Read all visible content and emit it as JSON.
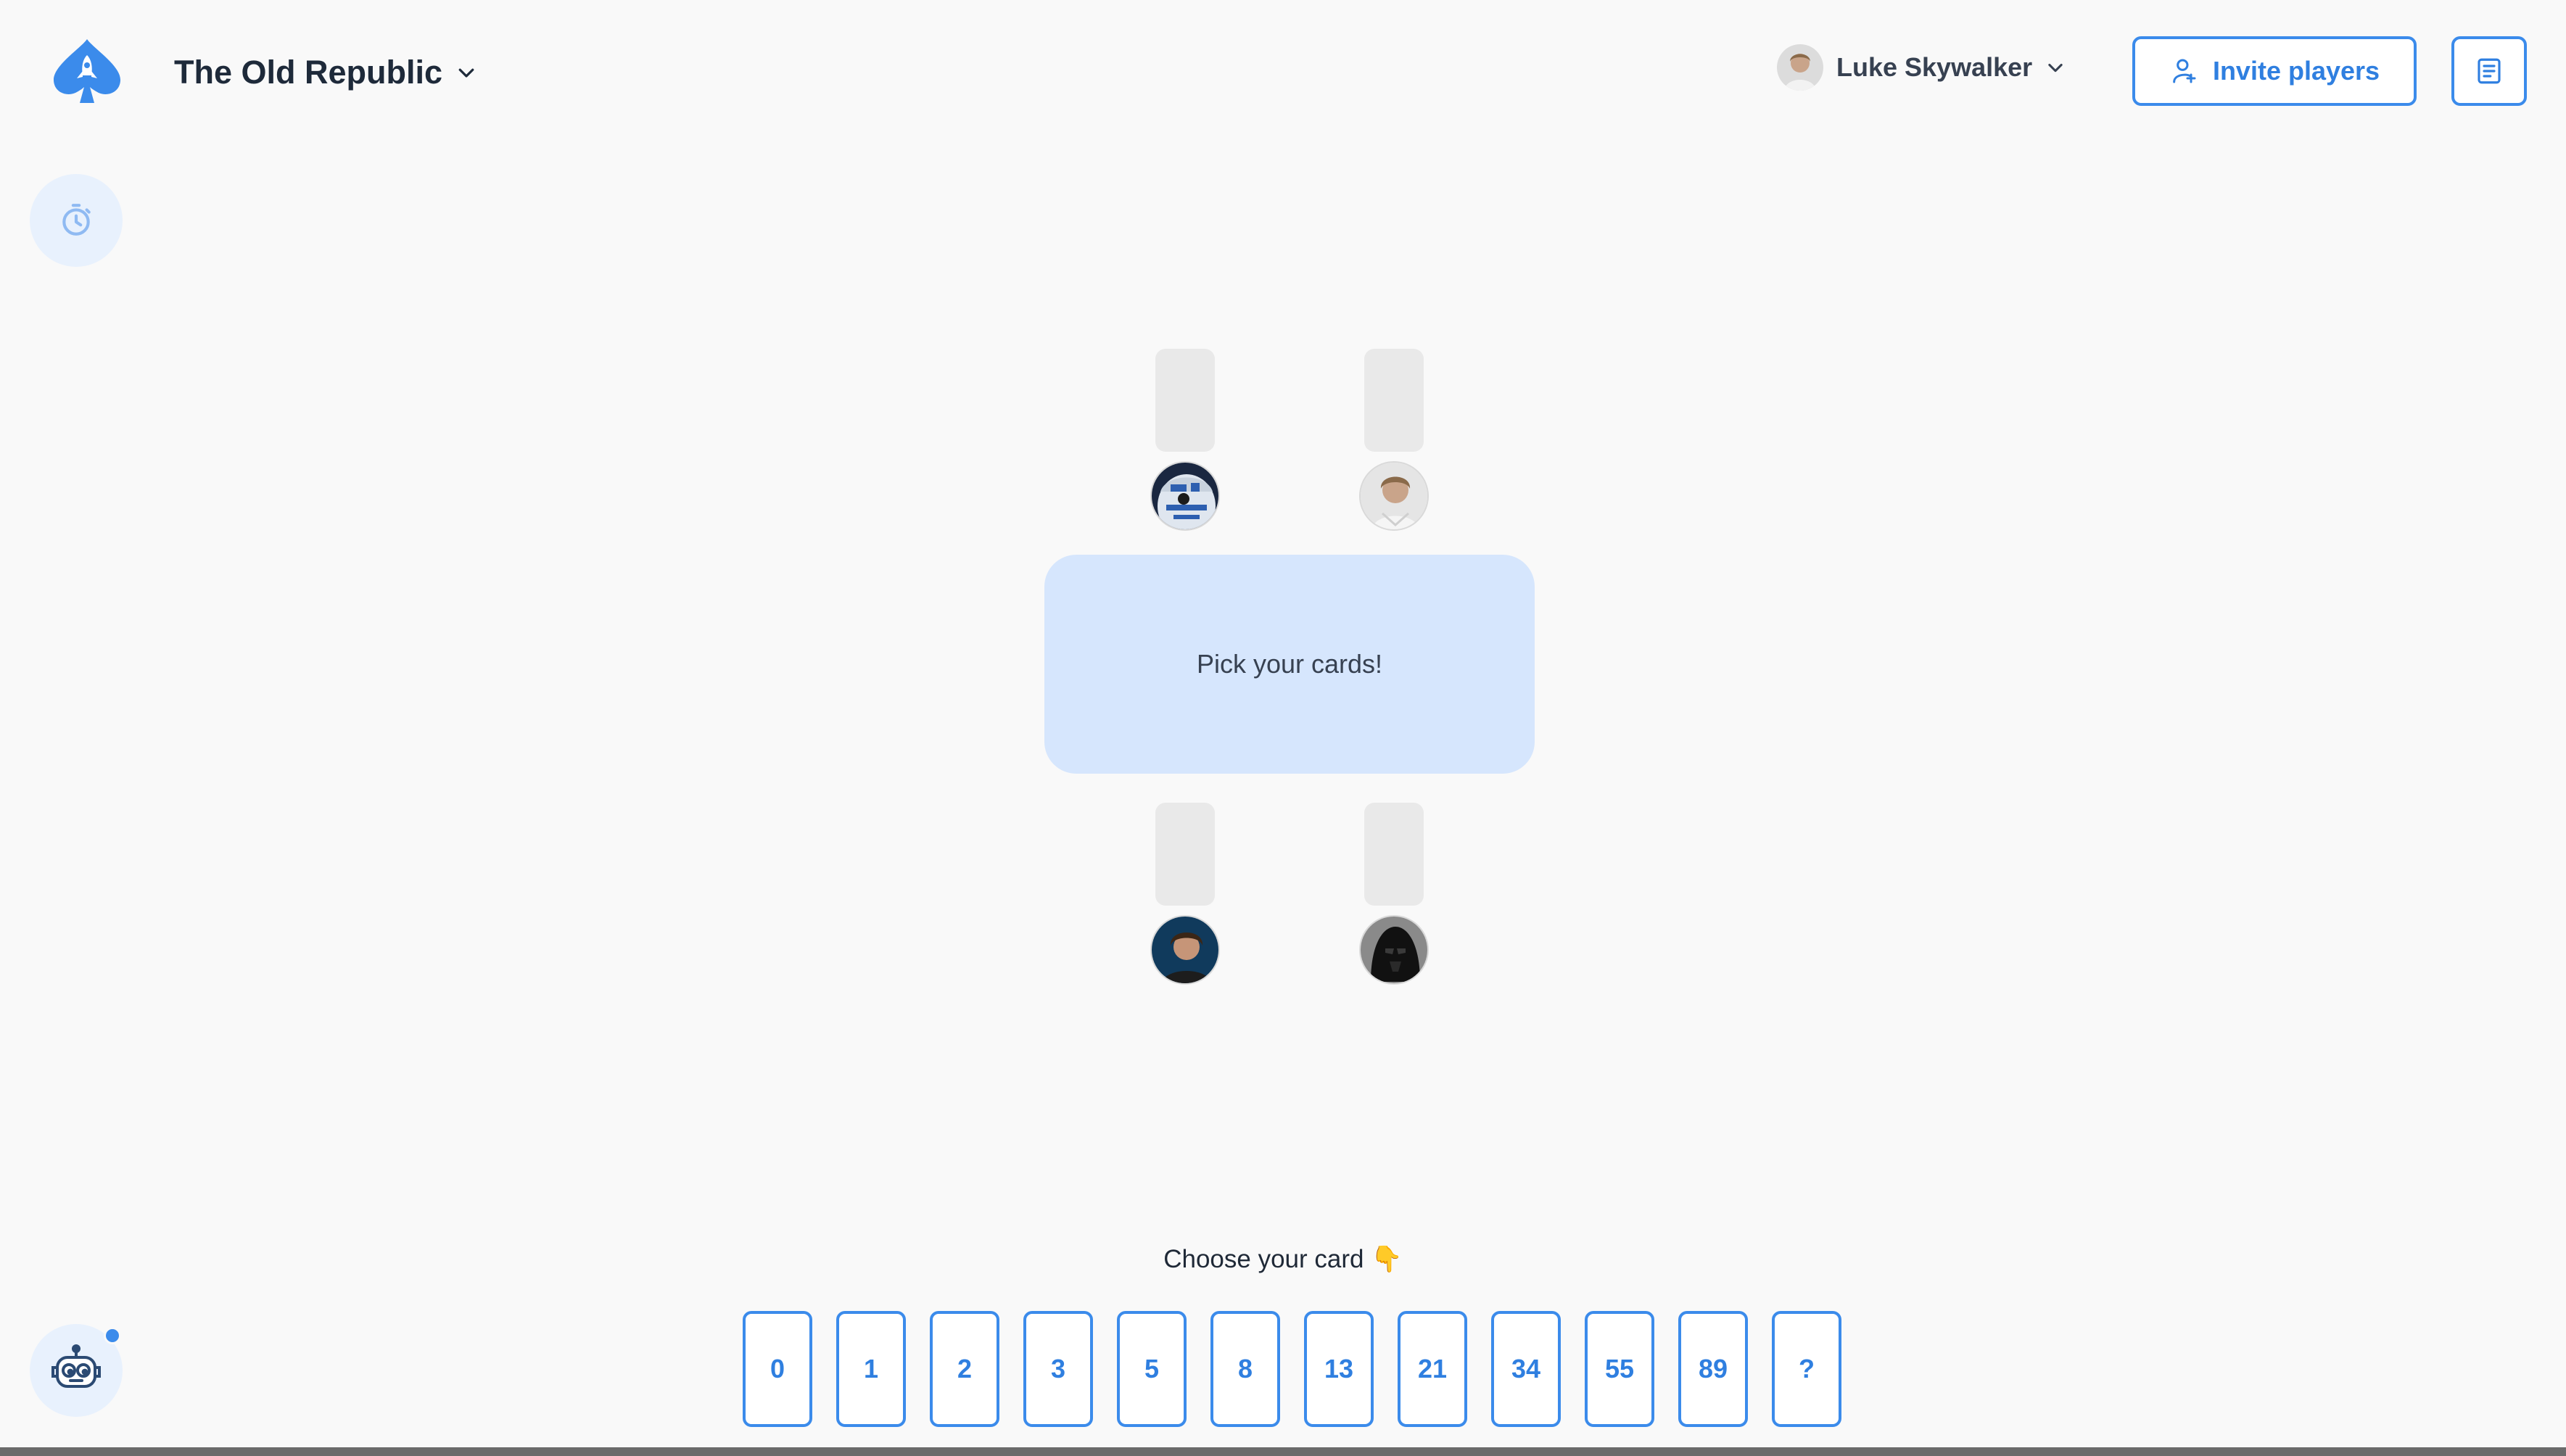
{
  "colors": {
    "accent": "#3b8beb",
    "table": "#d6e6fd",
    "slot": "#e9e9e9",
    "background": "#f9f9f9"
  },
  "header": {
    "logo_icon": "spade-rocket-logo-icon",
    "room_title": "The Old Republic",
    "user_name": "Luke Skywalker",
    "invite_label": "Invite players",
    "notes_icon": "document-icon"
  },
  "side_buttons": {
    "timer_icon": "stopwatch-icon",
    "bot_icon": "robot-icon"
  },
  "table": {
    "message": "Pick your cards!",
    "players_top": [
      {
        "avatar": "r2d2-avatar"
      },
      {
        "avatar": "luke-avatar"
      }
    ],
    "players_bottom": [
      {
        "avatar": "han-avatar"
      },
      {
        "avatar": "vader-avatar"
      }
    ]
  },
  "deck": {
    "label": "Choose your card 👇",
    "cards": [
      "0",
      "1",
      "2",
      "3",
      "5",
      "8",
      "13",
      "21",
      "34",
      "55",
      "89",
      "?"
    ]
  }
}
